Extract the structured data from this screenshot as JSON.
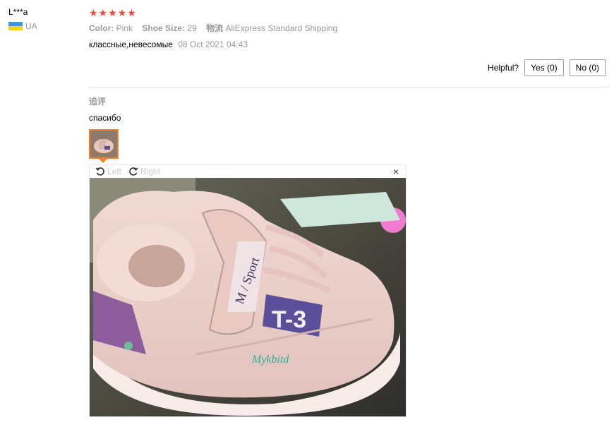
{
  "user": {
    "name": "L***a",
    "country": "UA"
  },
  "review": {
    "stars": "★★★★★",
    "meta": [
      {
        "key": "Color:",
        "value": "Pink"
      },
      {
        "key": "Shoe Size:",
        "value": "29"
      },
      {
        "key": "物流",
        "value": "AliExpress Standard Shipping"
      }
    ],
    "text": "классные,невесомые",
    "date": "08 Oct 2021 04:43"
  },
  "helpful": {
    "label": "Helpful?",
    "yes": "Yes (0)",
    "no": "No (0)"
  },
  "followup": {
    "label": "追评",
    "text": "спасибо"
  },
  "viewer": {
    "rotate_left": "Left",
    "rotate_right": "Right",
    "close": "×"
  },
  "colors": {
    "star": "#f04b3e",
    "thumb_border": "#f5822d"
  }
}
